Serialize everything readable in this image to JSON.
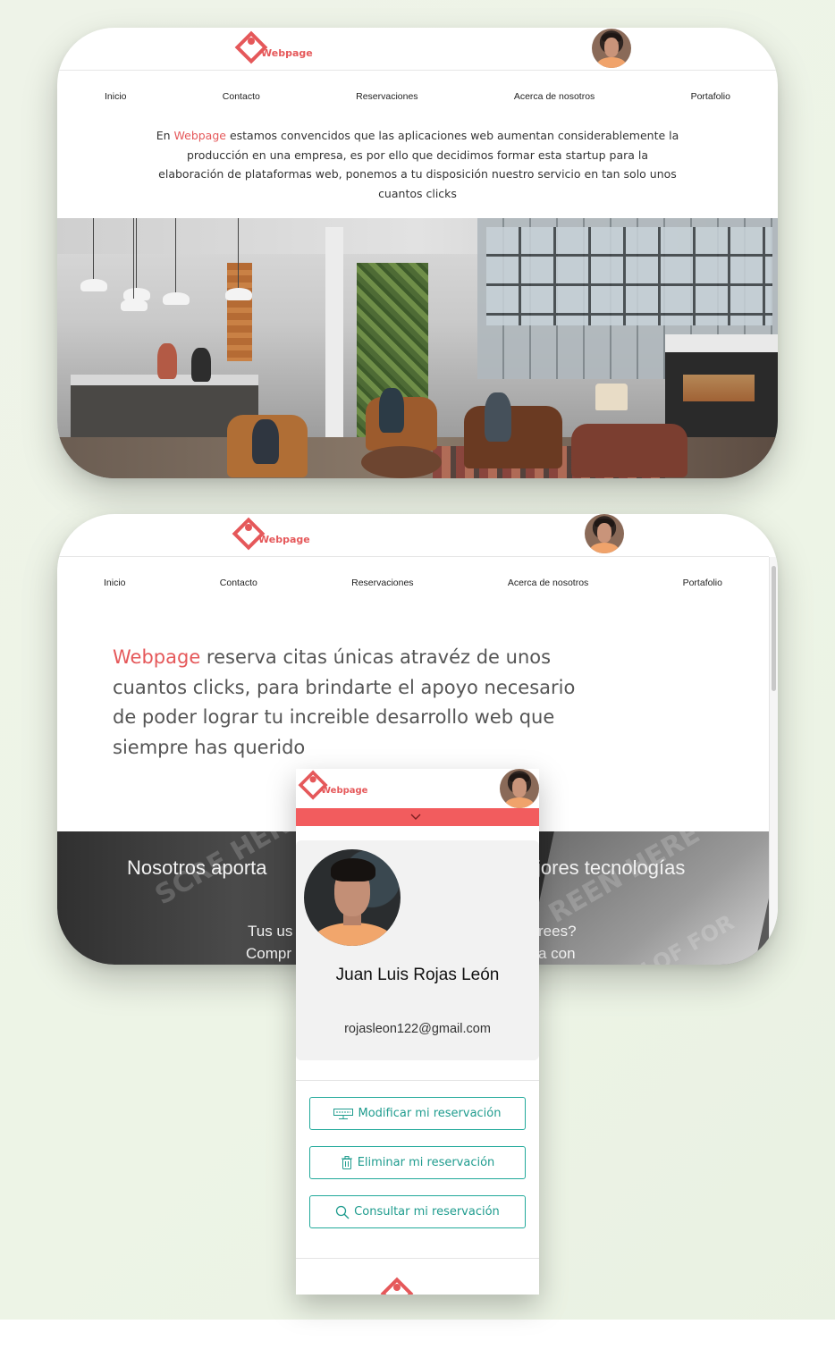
{
  "brand": {
    "name": "Webpage",
    "accent_color": "#e5585a",
    "teal_color": "#21a99a"
  },
  "nav": {
    "items": [
      "Inicio",
      "Contacto",
      "Reservaciones",
      "Acerca de nosotros",
      "Portafolio"
    ]
  },
  "card1": {
    "intro_prefix": "En ",
    "intro_brand": "Webpage",
    "intro_rest": " estamos convencidos que las aplicaciones web aumentan considerablemente la producción en una empresa, es por ello que decidimos formar esta startup para la elaboración de plataformas web, ponemos a tu disposición nuestro servicio en tan solo unos cuantos clicks",
    "image_subject": "office-lobby-photo"
  },
  "card2": {
    "hero_brand": "Webpage",
    "hero_rest": " reserva citas únicas atravéz de unos cuantos clicks, para brindarte el apoyo necesario de poder lograr tu increible desarrollo web que siempre has querido",
    "band_heading_left": "Nosotros aporta",
    "band_heading_right": "jores tecnologías",
    "band_sub_left_1": "Tus us",
    "band_sub_right_1": "rees?",
    "band_sub_left_2": "Compr",
    "band_sub_right_2": "a con",
    "decor_1": "SCRE HERE",
    "decor_2": "REEN HERE",
    "decor_3": "WILOF FOR YOU"
  },
  "mobile": {
    "user_name": "Juan Luis Rojas León",
    "user_email": "rojasleon122@gmail.com",
    "buttons": [
      {
        "label": "Modificar mi reservación",
        "icon": "reserved-sign-icon"
      },
      {
        "label": "Eliminar mi reservación",
        "icon": "trash-icon"
      },
      {
        "label": "Consultar mi reservación",
        "icon": "search-icon"
      }
    ]
  }
}
